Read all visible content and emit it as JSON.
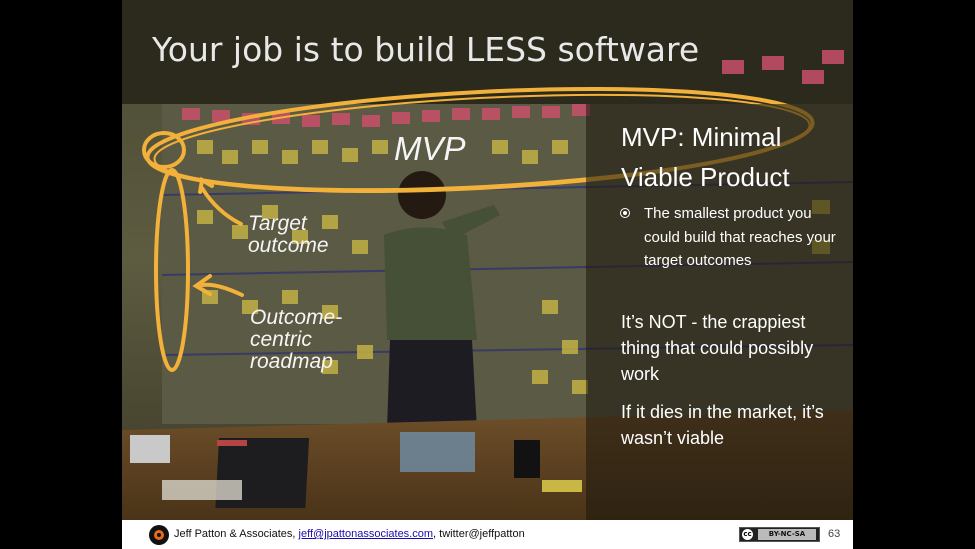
{
  "slide": {
    "title": "Your job is to build LESS software",
    "annotations": {
      "mvp": "MVP",
      "target": [
        "Target",
        "outcome"
      ],
      "roadmap": [
        "Outcome-",
        "centric",
        "roadmap"
      ]
    },
    "panel": {
      "heading": "MVP: Minimal Viable Product",
      "bullet": "The smallest product you could build that reaches your target outcomes",
      "para1": "It’s NOT - the crappiest thing that could possibly work",
      "para2": "If it dies in the market, it’s wasn’t viable"
    }
  },
  "footer": {
    "author": "Jeff Patton & Associates, ",
    "email": "jeff@jpattonassociates.com",
    "twitter": ", twitter@jeffpatton",
    "license": "BY-NC-SA",
    "cc": "cc",
    "page": "63"
  },
  "colors": {
    "sketch_orange": "#f2b13a",
    "background": "#000000"
  }
}
